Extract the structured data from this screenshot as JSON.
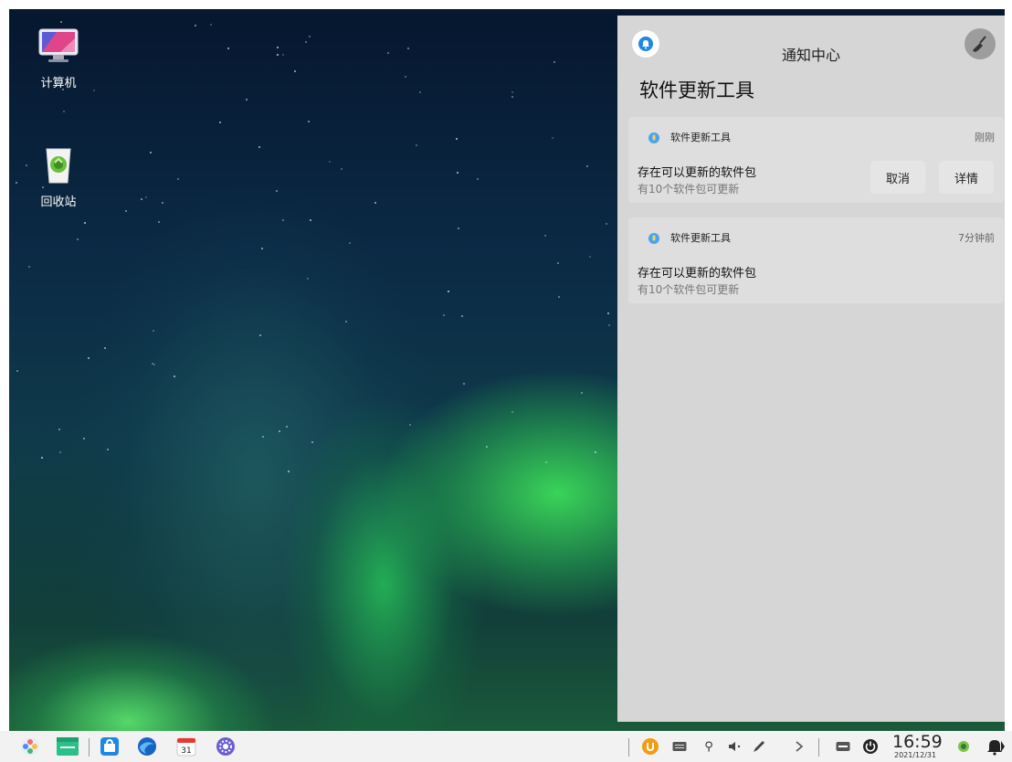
{
  "desktop": {
    "icons": [
      {
        "label": "计算机",
        "icon": "computer-icon"
      },
      {
        "label": "回收站",
        "icon": "trash-icon"
      }
    ]
  },
  "notification_center": {
    "title": "通知中心",
    "group_title": "软件更新工具",
    "notifications": [
      {
        "app_name": "软件更新工具",
        "time": "刚刚",
        "title": "存在可以更新的软件包",
        "body": "有10个软件包可更新",
        "actions": [
          "取消",
          "详情"
        ]
      },
      {
        "app_name": "软件更新工具",
        "time": "7分钟前",
        "title": "存在可以更新的软件包",
        "body": "有10个软件包可更新"
      }
    ]
  },
  "taskbar": {
    "left_items": [
      "start-menu-icon",
      "file-manager-icon",
      "app-store-icon",
      "browser-icon",
      "calendar-icon",
      "settings-icon"
    ],
    "calendar_day": "31",
    "tray_items": [
      "update-icon",
      "keyboard-icon",
      "usb-icon",
      "volume-icon",
      "pen-icon",
      "expand-icon",
      "input-method-icon",
      "power-icon"
    ],
    "clock": {
      "time": "16:59",
      "date": "2021/12/31"
    },
    "colors": {
      "accent_blue": "#1e88e5",
      "update_orange": "#f39c12",
      "trash_green": "#6cbf3a"
    }
  }
}
